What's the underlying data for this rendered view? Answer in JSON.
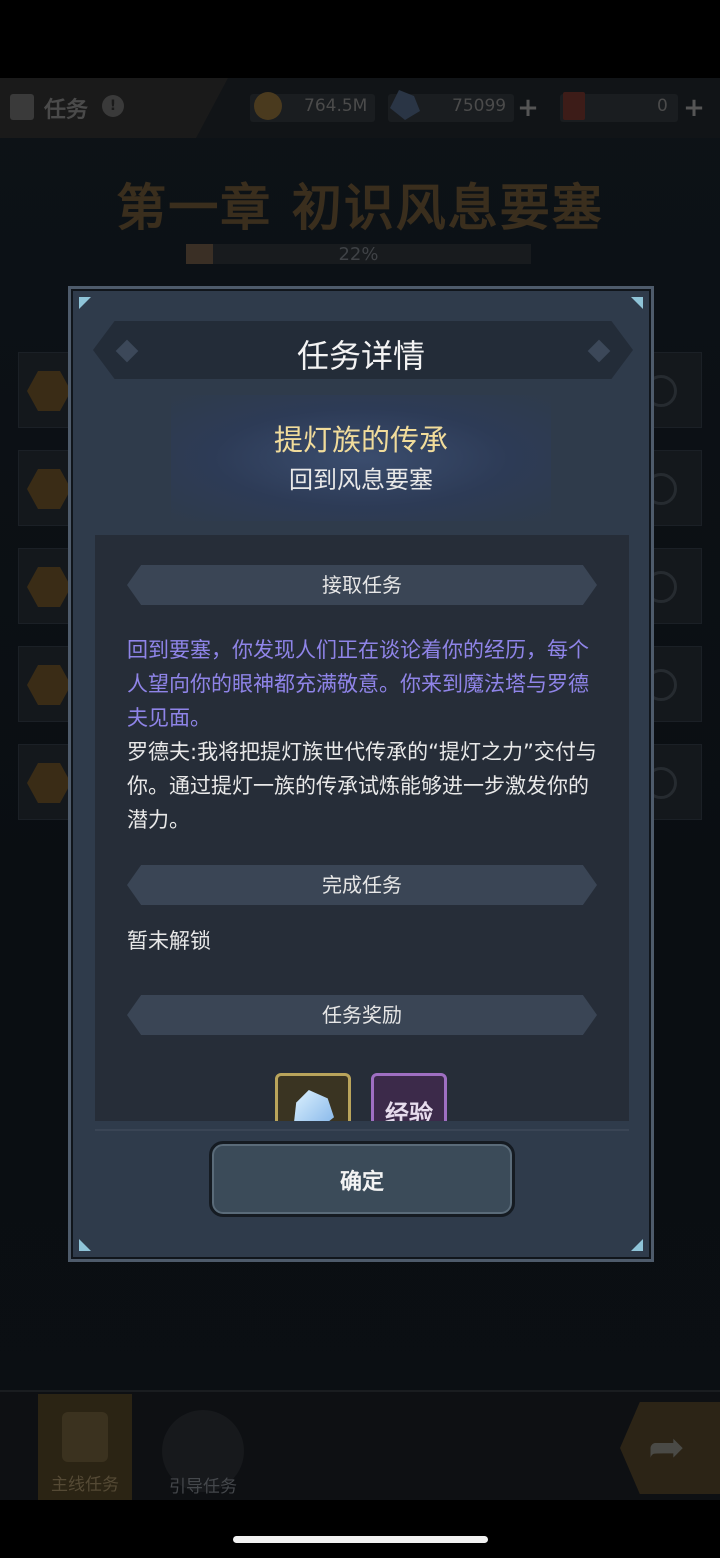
{
  "header": {
    "title": "任务",
    "info_icon": "!",
    "gold": "764.5M",
    "crystals": "75099",
    "tickets": "0",
    "plus": "+"
  },
  "chapter": {
    "title": "第一章 初识风息要塞",
    "progress_text": "22%",
    "progress": 0.22
  },
  "quest_list": {
    "rows": 5
  },
  "modal": {
    "title": "任务详情",
    "quest_name": "提灯族的传承",
    "quest_subtitle": "回到风息要塞",
    "section_accept": "接取任务",
    "story_purple": "回到要塞，你发现人们正在谈论着你的经历，每个人望向你的眼神都充满敬意。你来到魔法塔与罗德夫见面。",
    "story_white": "罗德夫:我将把提灯族世代传承的“提灯之力”交付与你。通过提灯一族的传承试炼能够进一步激发你的潜力。",
    "section_complete": "完成任务",
    "locked_text": "暂未解锁",
    "section_reward": "任务奖励",
    "reward_exp_label": "经验",
    "confirm": "确定"
  },
  "bottom_nav": {
    "main_tab": "主线任务",
    "guide_tab": "引导任务",
    "next_icon": "➦"
  },
  "colors": {
    "modal_bg": "#2f3b4b",
    "quest_name": "#f1dc9b",
    "story_purple": "#8f84e8"
  },
  "icons": [
    "task-scroll-icon",
    "info-icon",
    "gold-coin-icon",
    "crystal-icon",
    "ticket-book-icon",
    "plus-icon",
    "quest-badge-icon",
    "search-icon",
    "crystal-reward-icon",
    "exp-reward-icon",
    "scroll-icon",
    "guide-icon",
    "next-arrow-icon"
  ]
}
